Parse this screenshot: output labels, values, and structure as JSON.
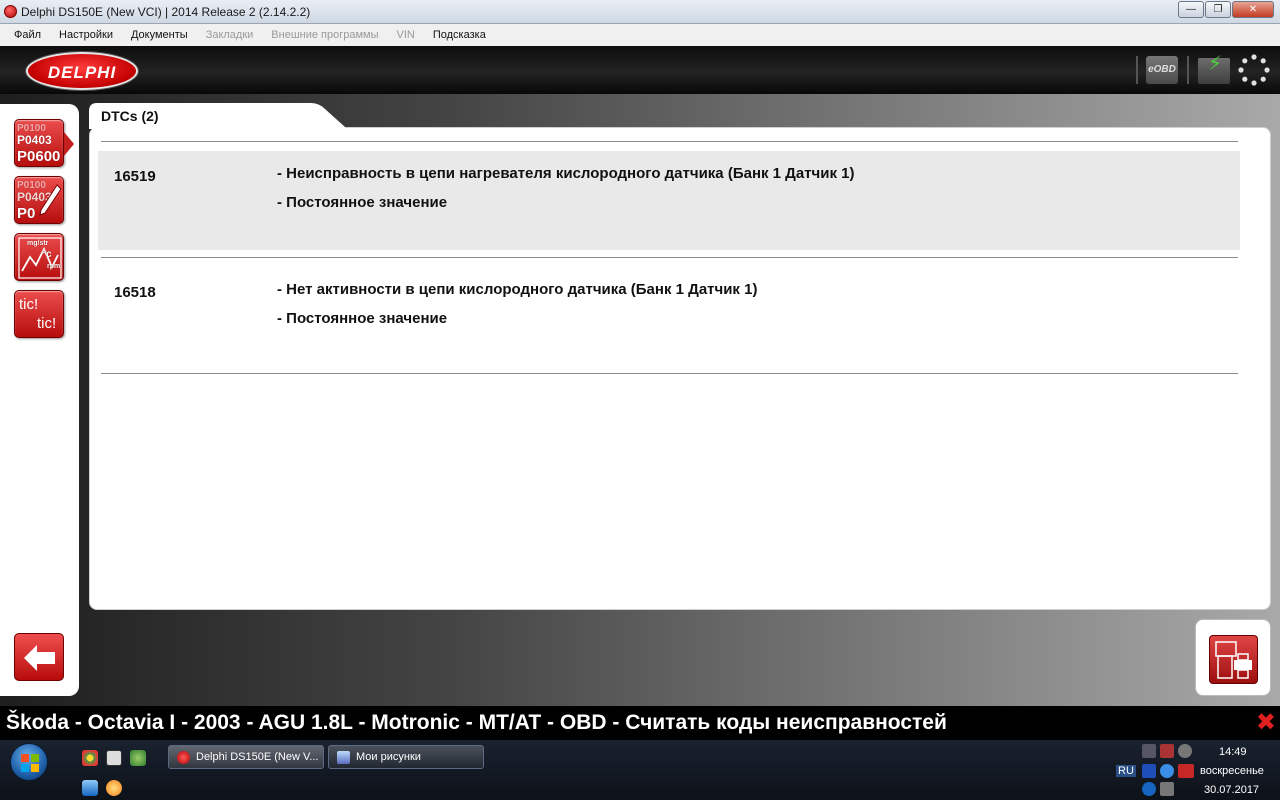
{
  "window": {
    "title": "Delphi DS150E (New VCI) | 2014 Release 2 (2.14.2.2)",
    "min_glyph": "—",
    "max_glyph": "❐",
    "close_glyph": "✕"
  },
  "menu": [
    {
      "label": "Файл",
      "enabled": true
    },
    {
      "label": "Настройки",
      "enabled": true
    },
    {
      "label": "Документы",
      "enabled": true
    },
    {
      "label": "Закладки",
      "enabled": false
    },
    {
      "label": "Внешние программы",
      "enabled": false
    },
    {
      "label": "VIN",
      "enabled": false
    },
    {
      "label": "Подсказка",
      "enabled": true
    }
  ],
  "header": {
    "logo_text": "DELPHI",
    "eobd_label": "eOBD"
  },
  "sidebar": {
    "dtc_button_codes": [
      "P0100",
      "P0403",
      "P0600"
    ],
    "clear_button_codes": [
      "P0100",
      "P0403",
      "P0"
    ],
    "live_data_labels": [
      "mg/str",
      "°c",
      "rpm"
    ],
    "tic_labels": [
      "tic!",
      "tic!"
    ]
  },
  "content": {
    "tab_label": "DTCs (2)",
    "dtcs": [
      {
        "code": "16519",
        "description": "- Неисправность в цепи нагревателя кислородного датчика (Банк 1 Датчик 1)",
        "status": "- Постоянное значение"
      },
      {
        "code": "16518",
        "description": "- Нет активности в цепи кислородного датчика (Банк 1 Датчик 1)",
        "status": "- Постоянное значение"
      }
    ]
  },
  "statusbar": {
    "text": "Škoda - Octavia I - 2003 - AGU 1.8L - Motronic - MT/AT - OBD - Считать коды неисправностей",
    "close_glyph": "✖"
  },
  "taskbar": {
    "tasks": [
      {
        "label": "Delphi DS150E (New V...",
        "active": true
      },
      {
        "label": "Мои рисунки",
        "active": false
      }
    ],
    "tray": {
      "language": "RU",
      "time": "14:49",
      "day": "воскресенье",
      "date": "30.07.2017"
    }
  },
  "colors": {
    "accent_red": "#c41f1f",
    "header_bg": "#1a1a1a",
    "row_shade": "#e9e9e9"
  }
}
